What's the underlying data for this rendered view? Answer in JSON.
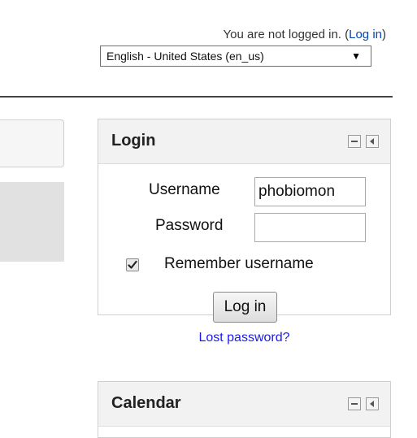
{
  "header": {
    "login_status_text": "You are not logged in. (",
    "login_link": "Log in",
    "login_status_suffix": ")",
    "language_selected": "English - United States (en_us)",
    "language_arrow": "▼"
  },
  "login_block": {
    "title": "Login",
    "username_label": "Username",
    "username_value": "phobiomon",
    "password_label": "Password",
    "password_value": "",
    "remember_label": "Remember username",
    "remember_checked": true,
    "submit_label": "Log in",
    "lost_password": "Lost password?"
  },
  "calendar_block": {
    "title": "Calendar"
  },
  "icons": {
    "hide_block": "minus-icon",
    "dock_block": "dock-arrow-icon",
    "checkbox": "checkmark-icon"
  }
}
